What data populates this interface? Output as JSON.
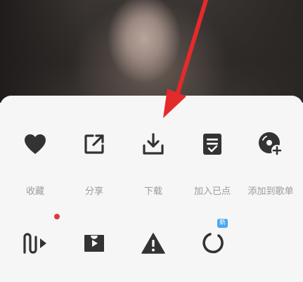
{
  "row1": [
    {
      "label": "收藏",
      "icon": "heart-icon"
    },
    {
      "label": "分享",
      "icon": "share-icon"
    },
    {
      "label": "下载",
      "icon": "download-icon"
    },
    {
      "label": "加入已点",
      "icon": "playlist-check-icon"
    },
    {
      "label": "添加到歌单",
      "icon": "add-to-songlist-icon"
    }
  ],
  "row2": [
    {
      "icon": "music-video-icon",
      "has_dot": true
    },
    {
      "icon": "video-play-icon"
    },
    {
      "icon": "warning-icon"
    },
    {
      "icon": "ring-icon",
      "badge": "新"
    }
  ],
  "colors": {
    "icon": "#333333",
    "label": "#9b9b9b",
    "arrow": "#e52a2a",
    "dot": "#e03a3a",
    "badge": "#49a8f0"
  }
}
